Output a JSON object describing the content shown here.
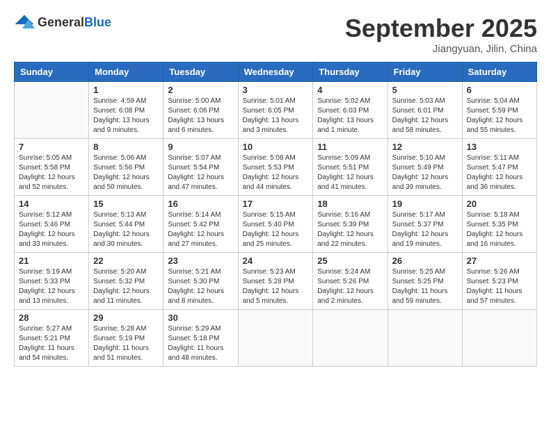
{
  "header": {
    "logo": {
      "general": "General",
      "blue": "Blue"
    },
    "title": "September 2025",
    "subtitle": "Jiangyuan, Jilin, China"
  },
  "calendar": {
    "days_of_week": [
      "Sunday",
      "Monday",
      "Tuesday",
      "Wednesday",
      "Thursday",
      "Friday",
      "Saturday"
    ],
    "weeks": [
      [
        {
          "day": "",
          "sunrise": "",
          "sunset": "",
          "daylight": "",
          "empty": true
        },
        {
          "day": "1",
          "sunrise": "Sunrise: 4:59 AM",
          "sunset": "Sunset: 6:08 PM",
          "daylight": "Daylight: 13 hours and 9 minutes."
        },
        {
          "day": "2",
          "sunrise": "Sunrise: 5:00 AM",
          "sunset": "Sunset: 6:06 PM",
          "daylight": "Daylight: 13 hours and 6 minutes."
        },
        {
          "day": "3",
          "sunrise": "Sunrise: 5:01 AM",
          "sunset": "Sunset: 6:05 PM",
          "daylight": "Daylight: 13 hours and 3 minutes."
        },
        {
          "day": "4",
          "sunrise": "Sunrise: 5:02 AM",
          "sunset": "Sunset: 6:03 PM",
          "daylight": "Daylight: 13 hours and 1 minute."
        },
        {
          "day": "5",
          "sunrise": "Sunrise: 5:03 AM",
          "sunset": "Sunset: 6:01 PM",
          "daylight": "Daylight: 12 hours and 58 minutes."
        },
        {
          "day": "6",
          "sunrise": "Sunrise: 5:04 AM",
          "sunset": "Sunset: 5:59 PM",
          "daylight": "Daylight: 12 hours and 55 minutes."
        }
      ],
      [
        {
          "day": "7",
          "sunrise": "Sunrise: 5:05 AM",
          "sunset": "Sunset: 5:58 PM",
          "daylight": "Daylight: 12 hours and 52 minutes."
        },
        {
          "day": "8",
          "sunrise": "Sunrise: 5:06 AM",
          "sunset": "Sunset: 5:56 PM",
          "daylight": "Daylight: 12 hours and 50 minutes."
        },
        {
          "day": "9",
          "sunrise": "Sunrise: 5:07 AM",
          "sunset": "Sunset: 5:54 PM",
          "daylight": "Daylight: 12 hours and 47 minutes."
        },
        {
          "day": "10",
          "sunrise": "Sunrise: 5:08 AM",
          "sunset": "Sunset: 5:53 PM",
          "daylight": "Daylight: 12 hours and 44 minutes."
        },
        {
          "day": "11",
          "sunrise": "Sunrise: 5:09 AM",
          "sunset": "Sunset: 5:51 PM",
          "daylight": "Daylight: 12 hours and 41 minutes."
        },
        {
          "day": "12",
          "sunrise": "Sunrise: 5:10 AM",
          "sunset": "Sunset: 5:49 PM",
          "daylight": "Daylight: 12 hours and 39 minutes."
        },
        {
          "day": "13",
          "sunrise": "Sunrise: 5:11 AM",
          "sunset": "Sunset: 5:47 PM",
          "daylight": "Daylight: 12 hours and 36 minutes."
        }
      ],
      [
        {
          "day": "14",
          "sunrise": "Sunrise: 5:12 AM",
          "sunset": "Sunset: 5:46 PM",
          "daylight": "Daylight: 12 hours and 33 minutes."
        },
        {
          "day": "15",
          "sunrise": "Sunrise: 5:13 AM",
          "sunset": "Sunset: 5:44 PM",
          "daylight": "Daylight: 12 hours and 30 minutes."
        },
        {
          "day": "16",
          "sunrise": "Sunrise: 5:14 AM",
          "sunset": "Sunset: 5:42 PM",
          "daylight": "Daylight: 12 hours and 27 minutes."
        },
        {
          "day": "17",
          "sunrise": "Sunrise: 5:15 AM",
          "sunset": "Sunset: 5:40 PM",
          "daylight": "Daylight: 12 hours and 25 minutes."
        },
        {
          "day": "18",
          "sunrise": "Sunrise: 5:16 AM",
          "sunset": "Sunset: 5:39 PM",
          "daylight": "Daylight: 12 hours and 22 minutes."
        },
        {
          "day": "19",
          "sunrise": "Sunrise: 5:17 AM",
          "sunset": "Sunset: 5:37 PM",
          "daylight": "Daylight: 12 hours and 19 minutes."
        },
        {
          "day": "20",
          "sunrise": "Sunrise: 5:18 AM",
          "sunset": "Sunset: 5:35 PM",
          "daylight": "Daylight: 12 hours and 16 minutes."
        }
      ],
      [
        {
          "day": "21",
          "sunrise": "Sunrise: 5:19 AM",
          "sunset": "Sunset: 5:33 PM",
          "daylight": "Daylight: 12 hours and 13 minutes."
        },
        {
          "day": "22",
          "sunrise": "Sunrise: 5:20 AM",
          "sunset": "Sunset: 5:32 PM",
          "daylight": "Daylight: 12 hours and 11 minutes."
        },
        {
          "day": "23",
          "sunrise": "Sunrise: 5:21 AM",
          "sunset": "Sunset: 5:30 PM",
          "daylight": "Daylight: 12 hours and 8 minutes."
        },
        {
          "day": "24",
          "sunrise": "Sunrise: 5:23 AM",
          "sunset": "Sunset: 5:28 PM",
          "daylight": "Daylight: 12 hours and 5 minutes."
        },
        {
          "day": "25",
          "sunrise": "Sunrise: 5:24 AM",
          "sunset": "Sunset: 5:26 PM",
          "daylight": "Daylight: 12 hours and 2 minutes."
        },
        {
          "day": "26",
          "sunrise": "Sunrise: 5:25 AM",
          "sunset": "Sunset: 5:25 PM",
          "daylight": "Daylight: 11 hours and 59 minutes."
        },
        {
          "day": "27",
          "sunrise": "Sunrise: 5:26 AM",
          "sunset": "Sunset: 5:23 PM",
          "daylight": "Daylight: 11 hours and 57 minutes."
        }
      ],
      [
        {
          "day": "28",
          "sunrise": "Sunrise: 5:27 AM",
          "sunset": "Sunset: 5:21 PM",
          "daylight": "Daylight: 11 hours and 54 minutes."
        },
        {
          "day": "29",
          "sunrise": "Sunrise: 5:28 AM",
          "sunset": "Sunset: 5:19 PM",
          "daylight": "Daylight: 11 hours and 51 minutes."
        },
        {
          "day": "30",
          "sunrise": "Sunrise: 5:29 AM",
          "sunset": "Sunset: 5:18 PM",
          "daylight": "Daylight: 11 hours and 48 minutes."
        },
        {
          "day": "",
          "sunrise": "",
          "sunset": "",
          "daylight": "",
          "empty": true
        },
        {
          "day": "",
          "sunrise": "",
          "sunset": "",
          "daylight": "",
          "empty": true
        },
        {
          "day": "",
          "sunrise": "",
          "sunset": "",
          "daylight": "",
          "empty": true
        },
        {
          "day": "",
          "sunrise": "",
          "sunset": "",
          "daylight": "",
          "empty": true
        }
      ]
    ]
  }
}
